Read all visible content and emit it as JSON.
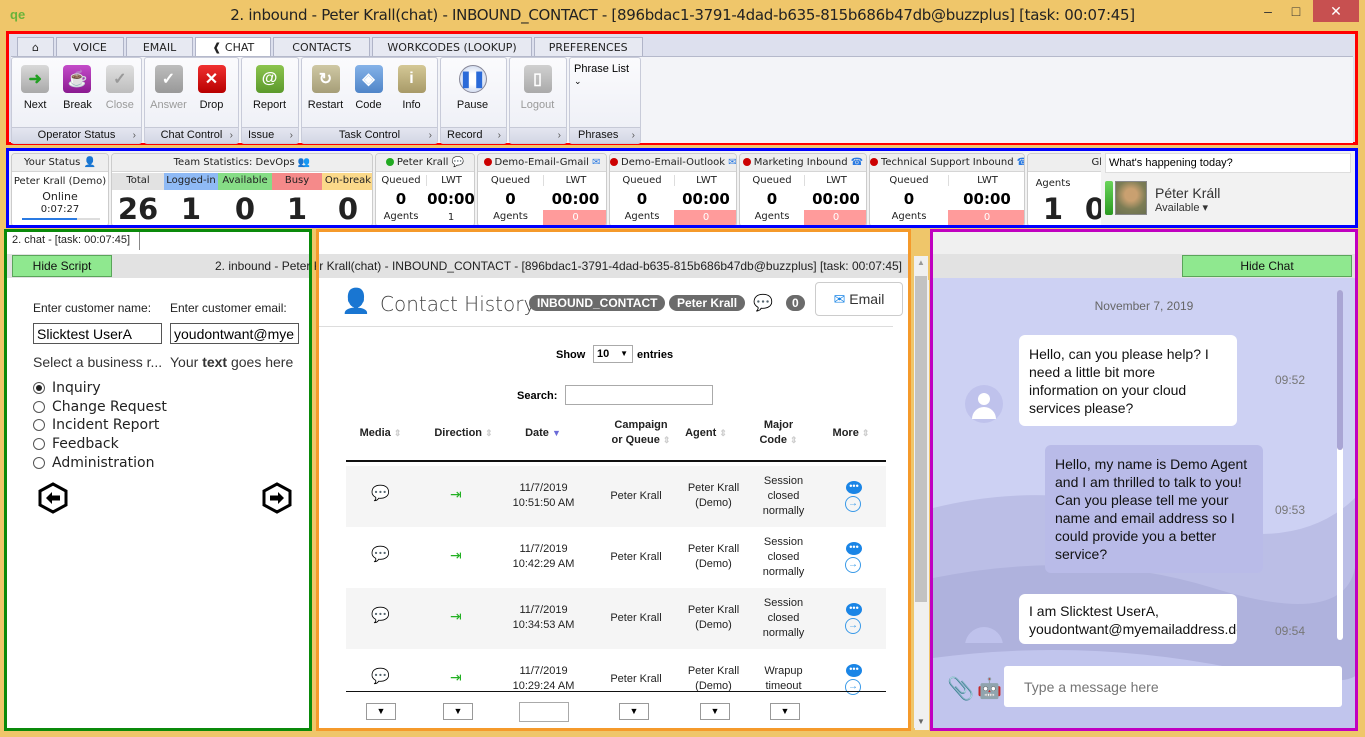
{
  "window": {
    "title": "2. inbound - Peter Krall(chat) - INBOUND_CONTACT - [896bdac1-3791-4dad-b635-815b686b47db@buzzplus] [task: 00:07:45]",
    "logo": "qe",
    "minimize": "–",
    "maximize": "□",
    "close": "✕"
  },
  "ribbon": {
    "tabs": [
      {
        "label": "⌂",
        "icon": "home-icon"
      },
      {
        "label": "VOICE"
      },
      {
        "label": "EMAIL"
      },
      {
        "label": "❰ CHAT",
        "active": true
      },
      {
        "label": "CONTACTS"
      },
      {
        "label": "WORKCODES (LOOKUP)"
      },
      {
        "label": "PREFERENCES"
      }
    ],
    "groups": [
      {
        "label": "Operator Status",
        "buttons": [
          {
            "label": "Next",
            "icon": "arrow-right-icon",
            "color": "#4caf50"
          },
          {
            "label": "Break",
            "icon": "coffee-cup-icon",
            "color": "#a020a8"
          },
          {
            "label": "Close",
            "icon": "checkmark-icon",
            "color": "#c4c4c4",
            "disabled": true
          }
        ]
      },
      {
        "label": "Chat Control",
        "buttons": [
          {
            "label": "Answer",
            "icon": "chat-check-icon",
            "color": "#a8a8a8",
            "disabled": true
          },
          {
            "label": "Drop",
            "icon": "chat-drop-icon",
            "color": "#e01818"
          }
        ]
      },
      {
        "label": "Issue",
        "buttons": [
          {
            "label": "Report",
            "icon": "at-sign-icon",
            "color": "#74b43e"
          }
        ]
      },
      {
        "label": "Task Control",
        "buttons": [
          {
            "label": "Restart",
            "icon": "restart-icon",
            "color": "#b8b08a"
          },
          {
            "label": "Code",
            "icon": "tag-icon",
            "color": "#6b9fd8"
          },
          {
            "label": "Info",
            "icon": "info-icon",
            "color": "#bcb080"
          }
        ]
      },
      {
        "label": "Record",
        "buttons": [
          {
            "label": "Pause",
            "icon": "pause-icon",
            "color": "#5a8ee0"
          }
        ]
      },
      {
        "label": "",
        "buttons": [
          {
            "label": "Logout",
            "icon": "logout-door-icon",
            "color": "#bdbdbd",
            "disabled": true
          }
        ]
      },
      {
        "label": "Phrases",
        "dropdown": "Phrase List"
      }
    ],
    "group_arrow": "›"
  },
  "status": {
    "your_status": {
      "header": "Your Status",
      "name": "Peter Krall (Demo)",
      "state": "Online",
      "timer": "0:07:27"
    },
    "team": {
      "header": "Team Statistics: DevOps",
      "columns": [
        {
          "label": "Total",
          "value": "26",
          "color": "#e2e2e2"
        },
        {
          "label": "Logged-in",
          "value": "1",
          "color": "#8fbaf5"
        },
        {
          "label": "Available",
          "value": "0",
          "color": "#86dd86"
        },
        {
          "label": "Busy",
          "value": "1",
          "color": "#f58a8a"
        },
        {
          "label": "On-break",
          "value": "0",
          "color": "#fbd98a"
        }
      ]
    },
    "queues": [
      {
        "name": "Peter Krall",
        "dot": "#22aa22",
        "icon": "chat-bubble-icon",
        "queued_label": "Queued",
        "queued": "0",
        "lwt_label": "LWT",
        "lwt": "00:00",
        "agents_label": "Agents",
        "agents": "1",
        "alert": false
      },
      {
        "name": "Demo-Email-Gmail",
        "dot": "#cc0000",
        "icon": "envelope-icon",
        "queued_label": "Queued",
        "queued": "0",
        "lwt_label": "LWT",
        "lwt": "00:00",
        "agents_label": "Agents",
        "agents": "0",
        "alert": true
      },
      {
        "name": "Demo-Email-Outlook",
        "dot": "#cc0000",
        "icon": "envelope-icon",
        "queued_label": "Queued",
        "queued": "0",
        "lwt_label": "LWT",
        "lwt": "00:00",
        "agents_label": "Agents",
        "agents": "0",
        "alert": true
      },
      {
        "name": "Marketing Inbound",
        "dot": "#cc0000",
        "icon": "phone-icon",
        "queued_label": "Queued",
        "queued": "0",
        "lwt_label": "LWT",
        "lwt": "00:00",
        "agents_label": "Agents",
        "agents": "0",
        "alert": true
      },
      {
        "name": "Technical Support Inbound",
        "dot": "#cc0000",
        "icon": "phone-icon",
        "queued_label": "Queued",
        "queued": "0",
        "lwt_label": "LWT",
        "lwt": "00:00",
        "agents_label": "Agents",
        "agents": "0",
        "alert": true
      }
    ],
    "global": {
      "header": "Gl",
      "agents_label": "Agents",
      "agents": "1",
      "next": "0"
    },
    "profile": {
      "whats_happening": "What's happening today?",
      "name": "Péter Králl",
      "availability": "Available ▾"
    }
  },
  "left": {
    "tab": "2. chat - [task: 00:07:45]",
    "hide_script": "Hide Script",
    "name_label": "Enter customer name:",
    "email_label": "Enter customer email:",
    "name_value": "Slicktest UserA",
    "email_value": "youdontwant@myemailaddress",
    "select_label": "Select a business r...",
    "text_prefix": "Your ",
    "text_bold": "text",
    "text_suffix": " goes here",
    "options": [
      {
        "label": "Inquiry",
        "selected": true
      },
      {
        "label": "Change Request",
        "selected": false
      },
      {
        "label": "Incident Report",
        "selected": false
      },
      {
        "label": "Feedback",
        "selected": false
      },
      {
        "label": "Administration",
        "selected": false
      }
    ],
    "prev_icon": "←",
    "next_icon": "→"
  },
  "center": {
    "header_title": "2. inbound - Peter Krall(chat) - INBOUND_CONTACT - [896bdac1-3791-4dad-b635-815b686b47db@buzzplus] [task: 00:07:45]",
    "title": "Contact History",
    "badge_contact": "INBOUND_CONTACT",
    "badge_agent": "Peter Krall",
    "count": "0",
    "email_button": "Email",
    "show_label": "Show",
    "show_value": "10",
    "entries_label": "entries",
    "search_label": "Search:",
    "search_value": "",
    "columns": [
      "Media",
      "Direction",
      "Date",
      "Campaign\nor Queue",
      "Agent",
      "Major\nCode",
      "More"
    ],
    "rows": [
      {
        "media": "chat",
        "direction": "inbound",
        "date": "11/7/2019",
        "time": "10:51:50 AM",
        "campaign": "Peter Krall",
        "agent1": "Peter Krall",
        "agent2": "(Demo)",
        "code": [
          "Session",
          "closed",
          "normally"
        ]
      },
      {
        "media": "chat",
        "direction": "inbound",
        "date": "11/7/2019",
        "time": "10:42:29 AM",
        "campaign": "Peter Krall",
        "agent1": "Peter Krall",
        "agent2": "(Demo)",
        "code": [
          "Session",
          "closed",
          "normally"
        ]
      },
      {
        "media": "chat",
        "direction": "inbound",
        "date": "11/7/2019",
        "time": "10:34:53 AM",
        "campaign": "Peter Krall",
        "agent1": "Peter Krall",
        "agent2": "(Demo)",
        "code": [
          "Session",
          "closed",
          "normally"
        ]
      },
      {
        "media": "chat",
        "direction": "inbound",
        "date": "11/7/2019",
        "time": "10:29:24 AM",
        "campaign": "Peter Krall",
        "agent1": "Peter Krall",
        "agent2": "(Demo)",
        "code": [
          "Wrapup",
          "timeout",
          ""
        ]
      }
    ]
  },
  "chat": {
    "hide_chat": "Hide Chat",
    "date": "November 7, 2019",
    "messages": [
      {
        "from": "customer",
        "text": "Hello, can you please help? I need a little bit more information on your cloud services please?",
        "time": "09:52"
      },
      {
        "from": "agent",
        "text": "Hello, my name is Demo Agent and I am thrilled to talk to you! Can you please tell me your name and email address so I could provide you a better service?",
        "time": "09:53"
      },
      {
        "from": "customer",
        "text": "I am Slicktest UserA, youdontwant@myemailaddress.dot",
        "time": "09:54"
      }
    ],
    "input_placeholder": "Type a message here"
  }
}
